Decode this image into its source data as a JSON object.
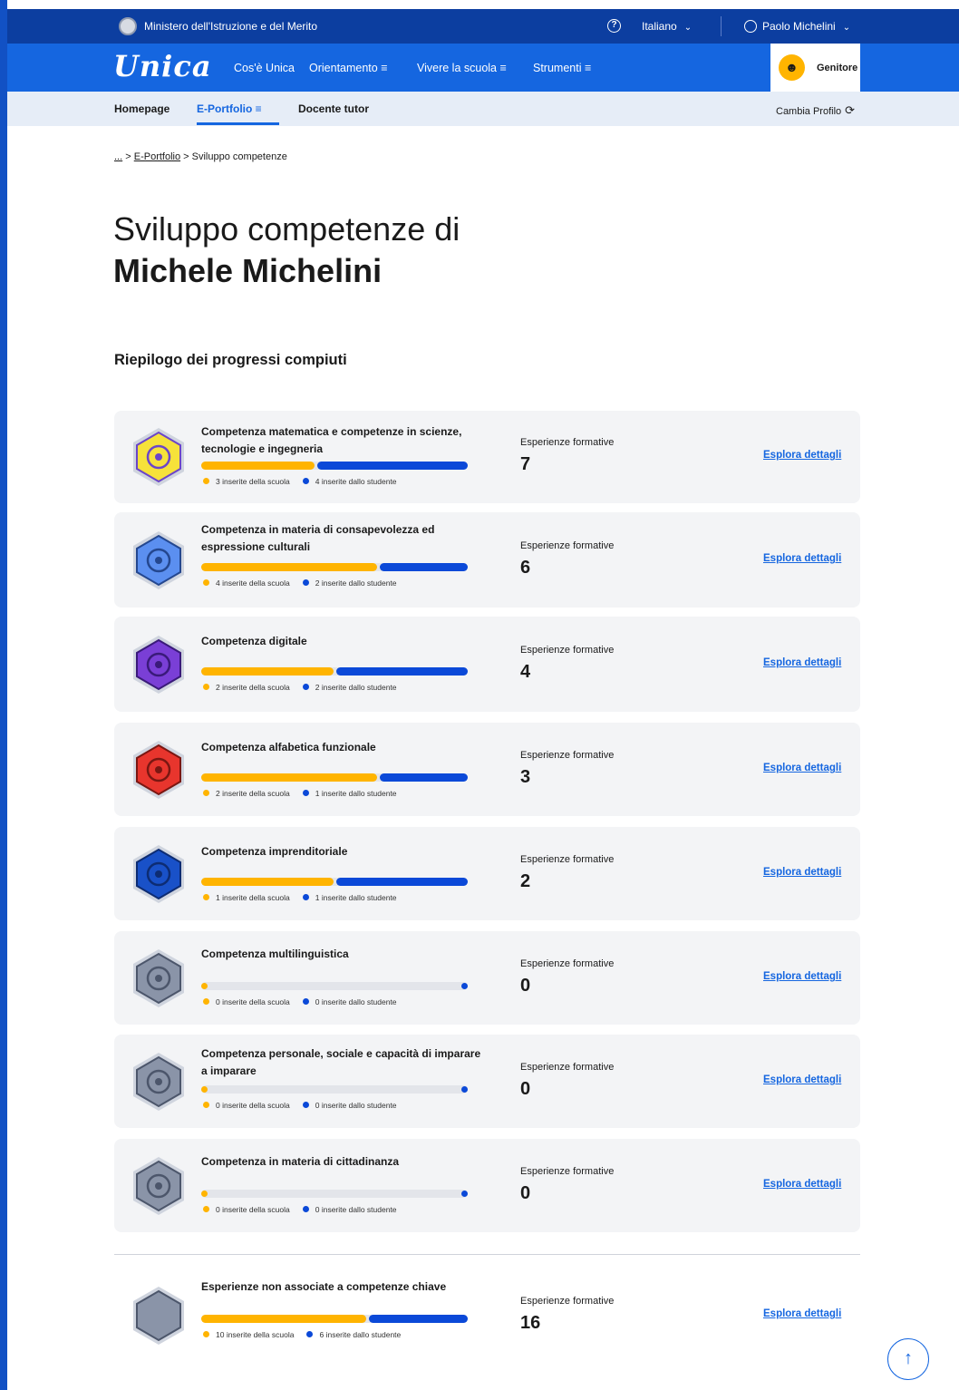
{
  "topbar": {
    "ministry": "Ministero dell'Istruzione e del Merito",
    "language": "Italiano",
    "user": "Paolo Michelini"
  },
  "mainnav": {
    "logo": "Unica",
    "items": [
      "Cos'è Unica",
      "Orientamento ≡",
      "Vivere la scuola ≡",
      "Strumenti ≡"
    ],
    "profile": "Genitore"
  },
  "subnav": {
    "items": [
      "Homepage",
      "E-Portfolio ≡",
      "Docente tutor"
    ],
    "change_profile": "Cambia Profilo"
  },
  "breadcrumb": {
    "ellipsis": "...",
    "sep1": ">",
    "link": "E-Portfolio",
    "sep2": ">",
    "current": "Sviluppo competenze"
  },
  "page": {
    "title_line1": "Sviluppo competenze di",
    "title_line2": "Michele Michelini",
    "summary_title": "Riepilogo dei progressi compiuti"
  },
  "exp_label": "Esperienze formative",
  "explore_label": "Esplora dettagli",
  "competences": [
    {
      "title": "Competenza matematica e competenze in scienze, tecnologie e ingegneria",
      "school": 3,
      "student": 4,
      "total": 7,
      "school_text": "3 inserite della scuola",
      "student_text": "4 inserite dallo studente",
      "badge_color": "#f6e23a",
      "badge_stroke": "#6b45c9",
      "icon": "atom-icon"
    },
    {
      "title": "Competenza in materia di consapevolezza ed espressione culturali",
      "school": 4,
      "student": 2,
      "total": 6,
      "school_text": "4 inserite della scuola",
      "student_text": "2 inserite dallo studente",
      "badge_color": "#5b8ff0",
      "badge_stroke": "#24478f",
      "icon": "books-icon"
    },
    {
      "title": "Competenza digitale",
      "school": 2,
      "student": 2,
      "total": 4,
      "school_text": "2 inserite della scuola",
      "student_text": "2 inserite dallo studente",
      "badge_color": "#7a3fd6",
      "badge_stroke": "#3a1a7a",
      "icon": "monitor-icon"
    },
    {
      "title": "Competenza alfabetica funzionale",
      "school": 2,
      "student": 1,
      "total": 3,
      "school_text": "2 inserite della scuola",
      "student_text": "1 inserite dallo studente",
      "badge_color": "#e8352d",
      "badge_stroke": "#7a1712",
      "icon": "lightbulb-pencil-icon"
    },
    {
      "title": "Competenza imprenditoriale",
      "school": 1,
      "student": 1,
      "total": 2,
      "school_text": "1 inserite della scuola",
      "student_text": "1 inserite dallo studente",
      "badge_color": "#1951c8",
      "badge_stroke": "#0d2c73",
      "icon": "rocket-icon"
    },
    {
      "title": "Competenza multilinguistica",
      "school": 0,
      "student": 0,
      "total": 0,
      "school_text": "0 inserite della scuola",
      "student_text": "0 inserite dallo studente",
      "badge_color": "#8a94a8",
      "badge_stroke": "#4c566b",
      "icon": "globe-letters-icon"
    },
    {
      "title": "Competenza personale, sociale e capacità di imparare a imparare",
      "school": 0,
      "student": 0,
      "total": 0,
      "school_text": "0 inserite della scuola",
      "student_text": "0 inserite dallo studente",
      "badge_color": "#8a94a8",
      "badge_stroke": "#4c566b",
      "icon": "graduation-globe-icon"
    },
    {
      "title": "Competenza in materia di cittadinanza",
      "school": 0,
      "student": 0,
      "total": 0,
      "school_text": "0 inserite della scuola",
      "student_text": "0 inserite dallo studente",
      "badge_color": "#8a94a8",
      "badge_stroke": "#4c566b",
      "icon": "medal-star-icon"
    },
    {
      "title": "Esperienze non associate a competenze chiave",
      "school": 10,
      "student": 6,
      "total": 16,
      "school_text": "10 inserite della scuola",
      "student_text": "6 inserite dallo studente",
      "badge_color": "#8a94a8",
      "badge_stroke": "#4c566b",
      "icon": "empty-hexagon-icon"
    }
  ]
}
